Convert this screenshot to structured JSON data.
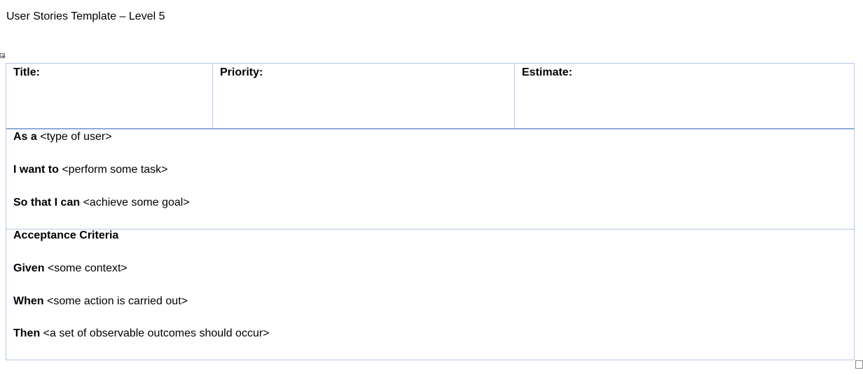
{
  "document": {
    "title": "User Stories Template – Level 5"
  },
  "table": {
    "header": {
      "title_label": "Title:",
      "priority_label": "Priority:",
      "estimate_label": "Estimate:"
    },
    "story": {
      "as_a_label": "As a",
      "as_a_value": " <type of user>",
      "want_label": "I want to",
      "want_value": " <perform some task>",
      "so_that_label": "So that I can",
      "so_that_value": " <achieve some goal>"
    },
    "criteria": {
      "heading": "Acceptance Criteria",
      "given_label": "Given",
      "given_value": " <some context>",
      "when_label": "When",
      "when_value": " <some action is carried out>",
      "then_label": "Then",
      "then_value": " <a set of observable outcomes should occur>"
    }
  },
  "icons": {
    "table_move_handle": "table-move-icon",
    "table_resize_handle": "table-resize-icon"
  }
}
